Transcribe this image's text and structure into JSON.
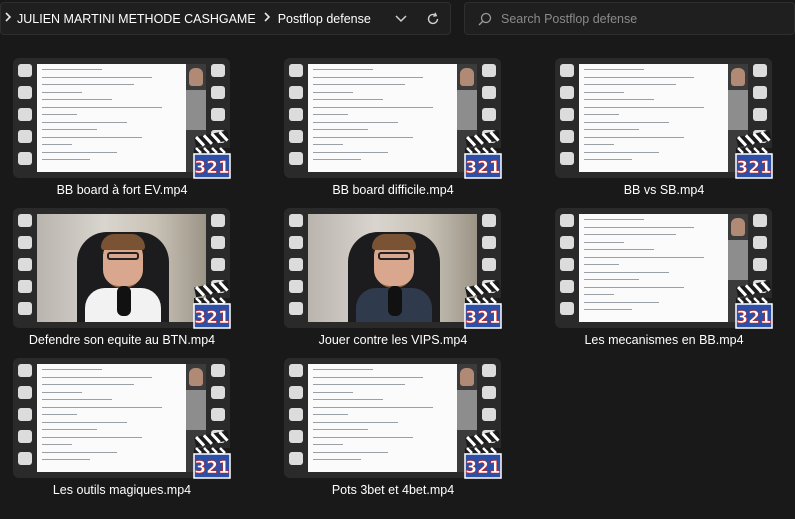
{
  "breadcrumb": {
    "path_1": "JULIEN MARTINI METHODE CASHGAME",
    "path_2": "Postflop defense"
  },
  "search": {
    "placeholder": "Search Postflop defense"
  },
  "files": [
    {
      "name": "BB board à fort EV.mp4",
      "thumbnail": "document"
    },
    {
      "name": "BB board difficile.mp4",
      "thumbnail": "document"
    },
    {
      "name": "BB vs SB.mp4",
      "thumbnail": "document"
    },
    {
      "name": "Defendre son equite au BTN.mp4",
      "thumbnail": "webcam"
    },
    {
      "name": "Jouer contre les VIPS.mp4",
      "thumbnail": "webcam"
    },
    {
      "name": "Les mecanismes en BB.mp4",
      "thumbnail": "document"
    },
    {
      "name": "Les outils magiques.mp4",
      "thumbnail": "document"
    },
    {
      "name": "Pots 3bet et 4bet.mp4",
      "thumbnail": "document"
    }
  ],
  "badge_text": "321",
  "colors": {
    "background": "#191919",
    "film_frame": "#2a2a2a",
    "badge_blue": "#2c4fa8",
    "badge_red": "#c8281e"
  },
  "icons": [
    "chevron-right-icon",
    "chevron-down-icon",
    "refresh-icon",
    "search-icon",
    "film-icon",
    "media-player-classic-badge-icon"
  ]
}
